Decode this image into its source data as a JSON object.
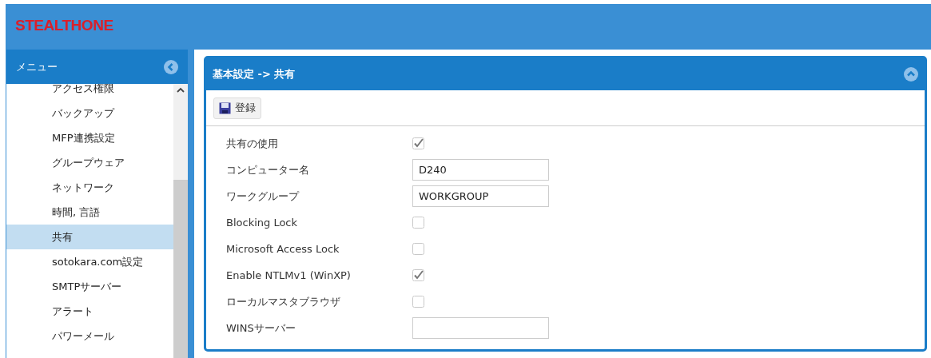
{
  "header": {
    "logo": "STEALTHONE"
  },
  "sidebar": {
    "title": "メニュー",
    "items": [
      {
        "label": "アクセス権限",
        "selected": false
      },
      {
        "label": "バックアップ",
        "selected": false
      },
      {
        "label": "MFP連携設定",
        "selected": false
      },
      {
        "label": "グループウェア",
        "selected": false
      },
      {
        "label": "ネットワーク",
        "selected": false
      },
      {
        "label": "時間, 言語",
        "selected": false
      },
      {
        "label": "共有",
        "selected": true
      },
      {
        "label": "sotokara.com設定",
        "selected": false
      },
      {
        "label": "SMTPサーバー",
        "selected": false
      },
      {
        "label": "アラート",
        "selected": false
      },
      {
        "label": "パワーメール",
        "selected": false
      }
    ]
  },
  "panel": {
    "title": "基本設定 -> 共有",
    "save_button": "登録",
    "fields": [
      {
        "kind": "checkbox",
        "label": "共有の使用",
        "checked": true
      },
      {
        "kind": "text",
        "label": "コンピューター名",
        "value": "D240"
      },
      {
        "kind": "text",
        "label": "ワークグループ",
        "value": "WORKGROUP"
      },
      {
        "kind": "checkbox",
        "label": "Blocking Lock",
        "checked": false
      },
      {
        "kind": "checkbox",
        "label": "Microsoft Access Lock",
        "checked": false
      },
      {
        "kind": "checkbox",
        "label": "Enable NTLMv1 (WinXP)",
        "checked": true
      },
      {
        "kind": "checkbox",
        "label": "ローカルマスタブラウザ",
        "checked": false
      },
      {
        "kind": "text",
        "label": "WINSサーバー"
      }
    ]
  }
}
